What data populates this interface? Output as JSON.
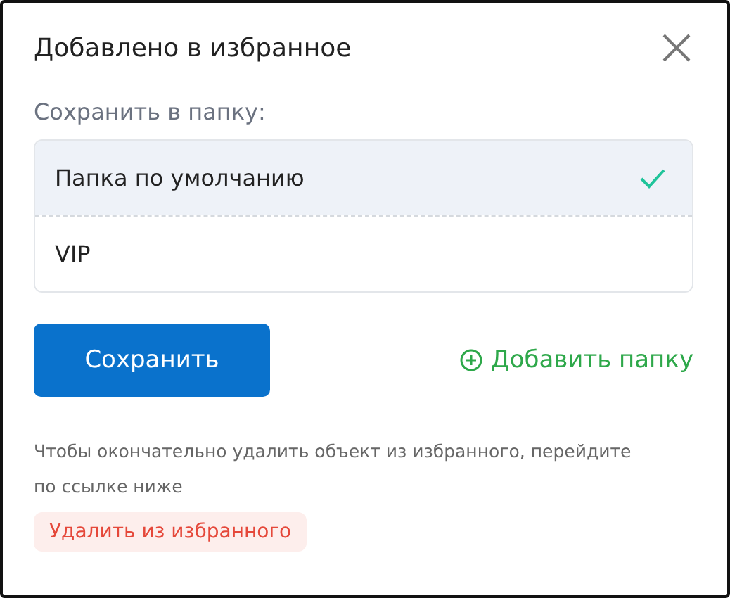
{
  "dialog": {
    "title": "Добавлено в избранное"
  },
  "folder_label": "Сохранить в папку:",
  "folders": [
    {
      "name": "Папка по умолчанию",
      "selected": true
    },
    {
      "name": "VIP",
      "selected": false
    }
  ],
  "save_button": "Сохранить",
  "add_folder": "Добавить папку",
  "note": "Чтобы окончательно удалить объект из избранного, перейдите по ссылке ниже",
  "remove_link": "Удалить из избранного"
}
